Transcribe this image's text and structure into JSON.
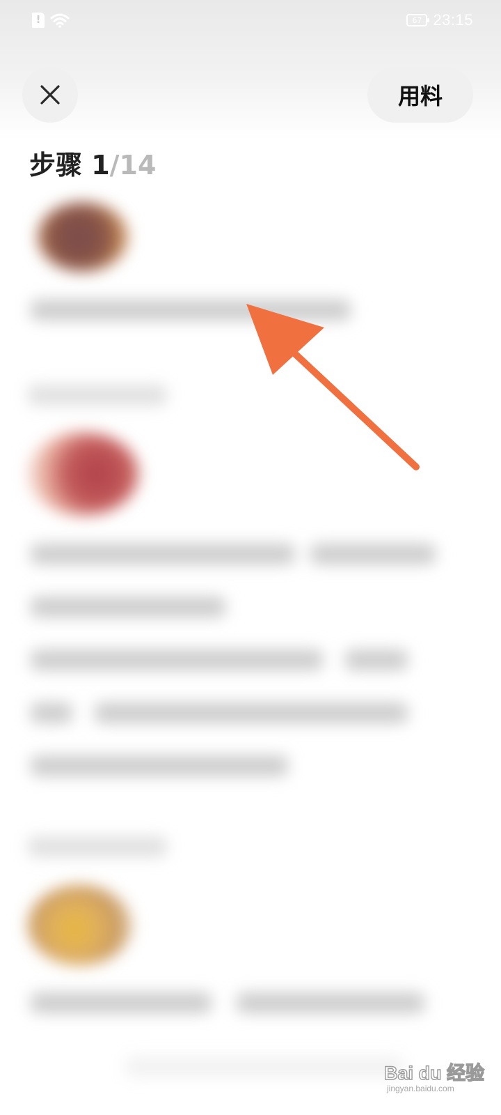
{
  "status_bar": {
    "battery_level": "67",
    "time": "23:15"
  },
  "header": {
    "close_icon": "close-icon",
    "ingredients_label": "用料"
  },
  "step": {
    "label": "步骤 1",
    "total": "/14"
  },
  "colors": {
    "arrow": "#f07040",
    "button_bg": "#f0f0f0"
  },
  "watermark": {
    "logo": "Bai du 经验",
    "url": "jingyan.baidu.com"
  }
}
